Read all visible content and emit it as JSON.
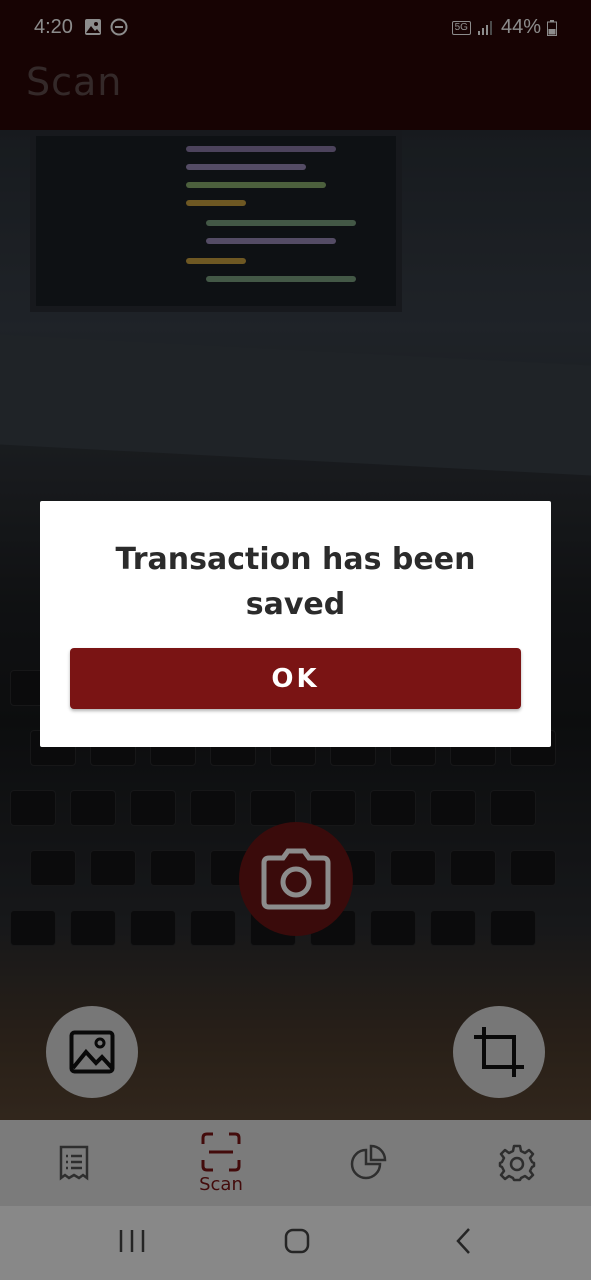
{
  "status_bar": {
    "time": "4:20",
    "network": "5G",
    "battery": "44%",
    "icons": [
      "gallery-notification-icon",
      "do-not-disturb-icon",
      "signal-icon",
      "battery-icon"
    ]
  },
  "app_bar": {
    "title": "Scan"
  },
  "dialog": {
    "message": "Transaction has been saved",
    "ok_label": "OK"
  },
  "bottom_nav": {
    "items": [
      {
        "icon": "receipt-icon",
        "label": ""
      },
      {
        "icon": "scan-icon",
        "label": "Scan"
      },
      {
        "icon": "pie-chart-icon",
        "label": ""
      },
      {
        "icon": "gear-icon",
        "label": ""
      }
    ]
  },
  "colors": {
    "app_bar": "#2a0707",
    "accent": "#7a1414",
    "dialog_bg": "#ffffff",
    "nav_bg": "#e0e0e0"
  }
}
